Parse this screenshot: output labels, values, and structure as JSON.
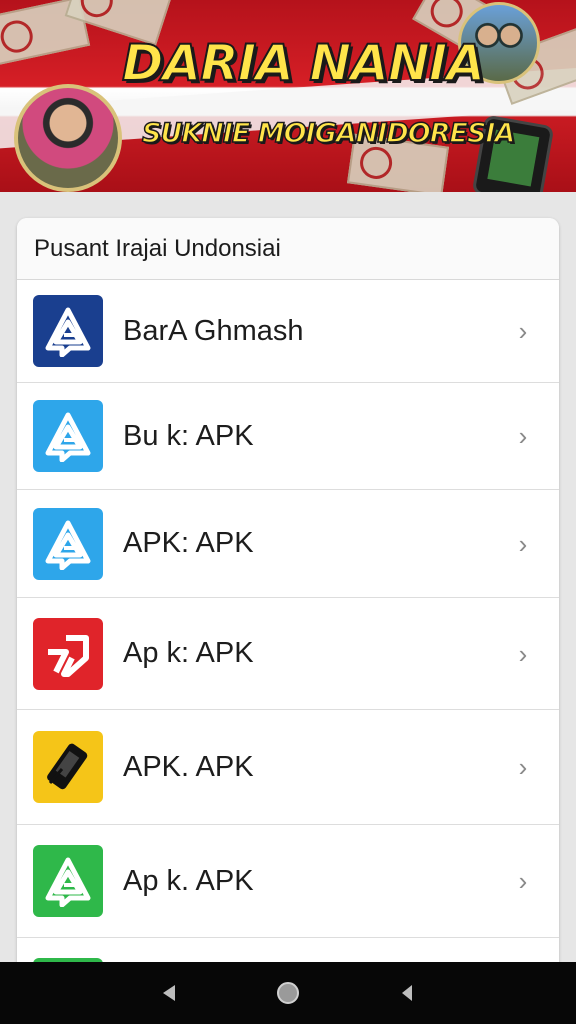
{
  "banner": {
    "title": "DARIA NANIA",
    "subtitle": "SUKNIE MOIGANIDORESIA"
  },
  "list": {
    "header": "Pusant Irajai Undonsiai",
    "items": [
      {
        "label": "BarA Ghmash",
        "icon": "delta-app-icon",
        "color": "#1a3f8f"
      },
      {
        "label": "Bu k: APK",
        "icon": "delta-app-icon",
        "color": "#2ea6ea"
      },
      {
        "label": "APK: APK",
        "icon": "delta-app-icon",
        "color": "#2ea6ea"
      },
      {
        "label": "Ap k: APK",
        "icon": "delta-app-icon",
        "color": "#e0242a"
      },
      {
        "label": "APK. APK",
        "icon": "phone-app-icon",
        "color": "#f5c518"
      },
      {
        "label": "Ap k. APK",
        "icon": "delta-app-icon",
        "color": "#2fb84a"
      }
    ]
  },
  "colors": {
    "banner_red": "#d61f26",
    "title_yellow": "#ffe44a",
    "navbar": "#070707"
  }
}
